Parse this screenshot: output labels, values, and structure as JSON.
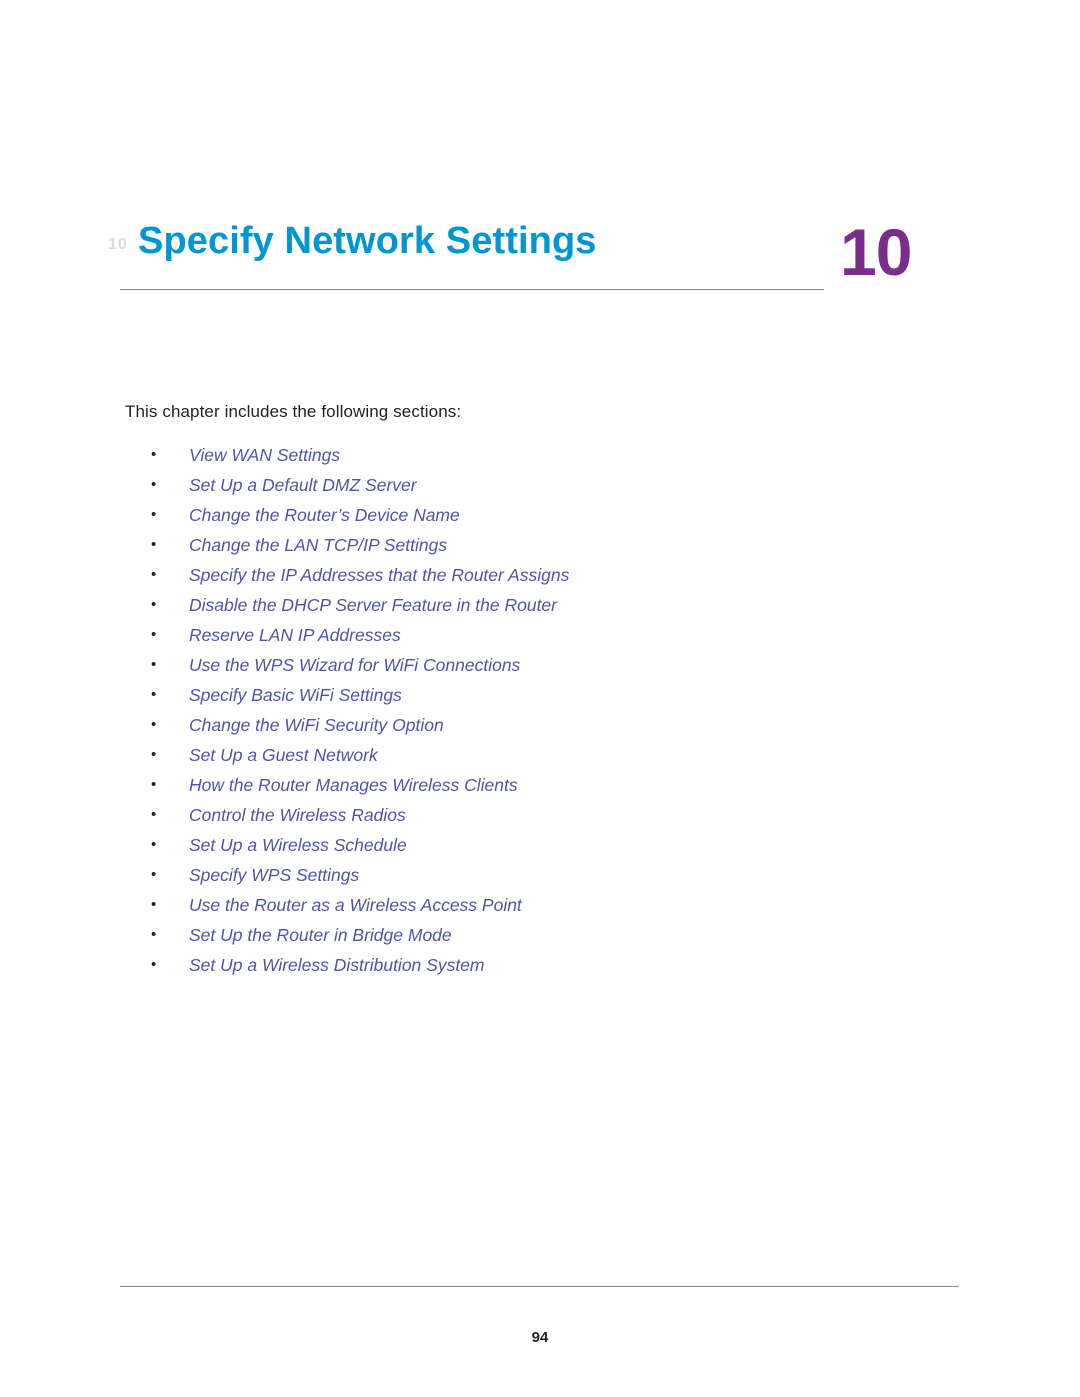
{
  "chapter": {
    "title": "Specify Network Settings",
    "number": "10",
    "watermark": "10"
  },
  "intro": "This chapter includes the following sections:",
  "bullet_glyph": "•",
  "sections": [
    {
      "label": "View WAN Settings"
    },
    {
      "label": "Set Up a Default DMZ Server"
    },
    {
      "label": "Change the Router’s Device Name"
    },
    {
      "label": "Change the LAN TCP/IP Settings"
    },
    {
      "label": "Specify the IP Addresses that the Router Assigns"
    },
    {
      "label": "Disable the DHCP Server Feature in the Router"
    },
    {
      "label": "Reserve LAN IP Addresses"
    },
    {
      "label": "Use the WPS Wizard for WiFi Connections"
    },
    {
      "label": "Specify Basic WiFi Settings"
    },
    {
      "label": "Change the WiFi Security Option"
    },
    {
      "label": "Set Up a Guest Network"
    },
    {
      "label": "How the Router Manages Wireless Clients"
    },
    {
      "label": "Control the Wireless Radios"
    },
    {
      "label": "Set Up a Wireless Schedule"
    },
    {
      "label": "Specify WPS Settings"
    },
    {
      "label": "Use the Router as a Wireless Access Point"
    },
    {
      "label": "Set Up the Router in Bridge Mode"
    },
    {
      "label": "Set Up a Wireless Distribution System"
    }
  ],
  "footer": {
    "page_number": "94"
  },
  "colors": {
    "title": "#0095d3",
    "chapter_number": "#7b2d8b",
    "link": "#4f54a8",
    "rule": "#8c8c8c"
  }
}
